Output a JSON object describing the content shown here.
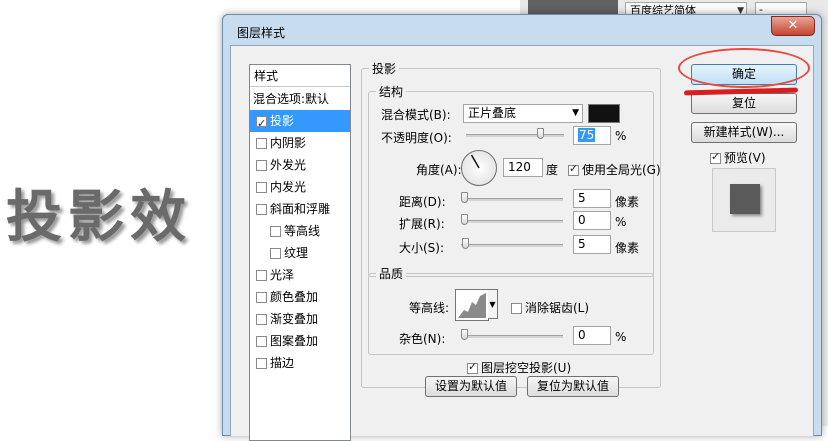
{
  "background": {
    "canvas_text": "投影效",
    "font_dropdown": "百度综艺简体",
    "small_field": "-"
  },
  "dialog": {
    "title": "图层样式",
    "close_label": "✕",
    "styles_header": "样式",
    "styles": [
      {
        "label": "混合选项:默认",
        "checkbox": false
      },
      {
        "label": "投影",
        "checkbox": true,
        "checked": true,
        "selected": true
      },
      {
        "label": "内阴影",
        "checkbox": true,
        "checked": false
      },
      {
        "label": "外发光",
        "checkbox": true,
        "checked": false
      },
      {
        "label": "内发光",
        "checkbox": true,
        "checked": false
      },
      {
        "label": "斜面和浮雕",
        "checkbox": true,
        "checked": false
      },
      {
        "label": "等高线",
        "checkbox": true,
        "checked": false,
        "indent": true
      },
      {
        "label": "纹理",
        "checkbox": true,
        "checked": false,
        "indent": true
      },
      {
        "label": "光泽",
        "checkbox": true,
        "checked": false
      },
      {
        "label": "颜色叠加",
        "checkbox": true,
        "checked": false
      },
      {
        "label": "渐变叠加",
        "checkbox": true,
        "checked": false
      },
      {
        "label": "图案叠加",
        "checkbox": true,
        "checked": false
      },
      {
        "label": "描边",
        "checkbox": true,
        "checked": false
      }
    ],
    "drop_shadow": {
      "section_title": "投影",
      "structure_title": "结构",
      "blend_mode_label": "混合模式(B):",
      "blend_mode_value": "正片叠底",
      "shadow_color": "#111111",
      "opacity_label": "不透明度(O):",
      "opacity_value": "75",
      "opacity_unit": "%",
      "opacity_fraction": 0.75,
      "angle_label": "角度(A):",
      "angle_value": "120",
      "angle_unit": "度",
      "global_light_label": "使用全局光(G)",
      "global_light_checked": true,
      "distance_label": "距离(D):",
      "distance_value": "5",
      "distance_unit": "像素",
      "spread_label": "扩展(R):",
      "spread_value": "0",
      "spread_unit": "%",
      "size_label": "大小(S):",
      "size_value": "5",
      "size_unit": "像素"
    },
    "quality": {
      "title": "品质",
      "contour_label": "等高线:",
      "antialias_label": "消除锯齿(L)",
      "antialias_checked": false,
      "noise_label": "杂色(N):",
      "noise_value": "0",
      "noise_unit": "%"
    },
    "knockout_label": "图层挖空投影(U)",
    "knockout_checked": true,
    "make_default_label": "设置为默认值",
    "reset_default_label": "复位为默认值",
    "ok_label": "确定",
    "reset_label": "复位",
    "new_style_label": "新建样式(W)...",
    "preview_label": "预览(V)",
    "preview_checked": true
  },
  "colors": {
    "annotation_red": "#e8483f",
    "selection_blue": "#3399ff"
  }
}
